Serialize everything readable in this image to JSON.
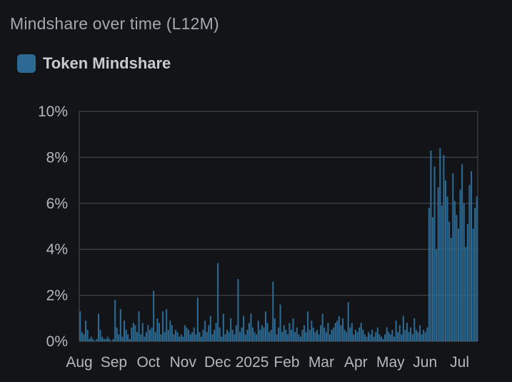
{
  "title": "Mindshare over time (L12M)",
  "legend": {
    "label": "Token Mindshare",
    "color": "#2c6a94"
  },
  "colors": {
    "bar": "#2c6a94",
    "grid": "#3a3c42",
    "axis_text": "#b4b7bd"
  },
  "chart_data": {
    "type": "bar",
    "title": "Mindshare over time (L12M)",
    "xlabel": "",
    "ylabel": "",
    "ylim": [
      0,
      10
    ],
    "y_ticks": [
      "0%",
      "2%",
      "4%",
      "6%",
      "8%",
      "10%"
    ],
    "x_ticks": [
      "Aug",
      "Sep",
      "Oct",
      "Nov",
      "Dec",
      "2025",
      "Feb",
      "Mar",
      "Apr",
      "May",
      "Jun",
      "Jul"
    ],
    "grid": true,
    "legend_position": "top-left",
    "series": [
      {
        "name": "Token Mindshare",
        "values": [
          1.3,
          0.4,
          0.3,
          0.9,
          0.5,
          0.1,
          0.2,
          0.1,
          0.0,
          0.1,
          1.2,
          0.5,
          0.2,
          0.1,
          0.1,
          0.2,
          0.1,
          0.0,
          0.1,
          1.8,
          0.6,
          0.3,
          1.4,
          0.2,
          0.9,
          0.5,
          0.3,
          0.1,
          0.6,
          0.8,
          0.7,
          0.4,
          1.3,
          0.3,
          0.8,
          0.2,
          0.4,
          0.7,
          0.5,
          0.6,
          2.2,
          0.4,
          1.0,
          0.8,
          0.3,
          1.3,
          0.4,
          1.4,
          0.5,
          0.9,
          0.7,
          0.3,
          0.5,
          0.4,
          0.2,
          0.3,
          0.2,
          0.7,
          0.6,
          0.5,
          0.3,
          0.4,
          0.6,
          0.3,
          1.9,
          0.4,
          0.2,
          0.5,
          0.9,
          0.4,
          0.7,
          1.1,
          0.3,
          0.5,
          0.8,
          3.4,
          0.6,
          0.2,
          1.2,
          0.3,
          0.5,
          0.4,
          1.0,
          0.5,
          0.3,
          0.7,
          2.7,
          0.4,
          0.6,
          1.1,
          0.3,
          0.5,
          0.8,
          1.2,
          0.6,
          0.4,
          0.3,
          0.9,
          0.5,
          0.7,
          0.6,
          1.3,
          0.8,
          0.4,
          0.5,
          2.6,
          1.0,
          0.3,
          0.6,
          1.6,
          0.4,
          0.7,
          0.5,
          0.3,
          0.8,
          0.5,
          1.0,
          0.4,
          0.6,
          0.3,
          0.2,
          0.5,
          0.7,
          0.4,
          1.3,
          0.5,
          0.9,
          0.6,
          0.4,
          0.5,
          0.3,
          0.7,
          1.2,
          0.6,
          0.4,
          0.8,
          0.3,
          0.5,
          0.6,
          0.8,
          0.9,
          1.1,
          0.7,
          1.0,
          0.5,
          0.4,
          1.7,
          0.6,
          0.8,
          0.3,
          0.5,
          0.4,
          0.6,
          0.8,
          0.5,
          0.3,
          0.2,
          0.4,
          0.3,
          0.5,
          0.2,
          0.4,
          0.6,
          0.3,
          0.2,
          0.1,
          0.3,
          0.6,
          0.4,
          0.3,
          0.5,
          0.2,
          0.9,
          0.4,
          0.7,
          0.3,
          1.1,
          0.5,
          0.8,
          0.4,
          0.6,
          0.3,
          1.0,
          0.5,
          0.4,
          0.7,
          0.3,
          0.5,
          0.4,
          0.6,
          5.8,
          8.3,
          5.4,
          7.6,
          4.0,
          6.7,
          8.4,
          5.9,
          8.1,
          7.0,
          6.3,
          5.2,
          4.5,
          7.3,
          6.1,
          5.5,
          4.9,
          6.6,
          7.7,
          6.0,
          4.1,
          5.1,
          6.8,
          7.4,
          4.9,
          5.8,
          6.3
        ]
      }
    ]
  }
}
